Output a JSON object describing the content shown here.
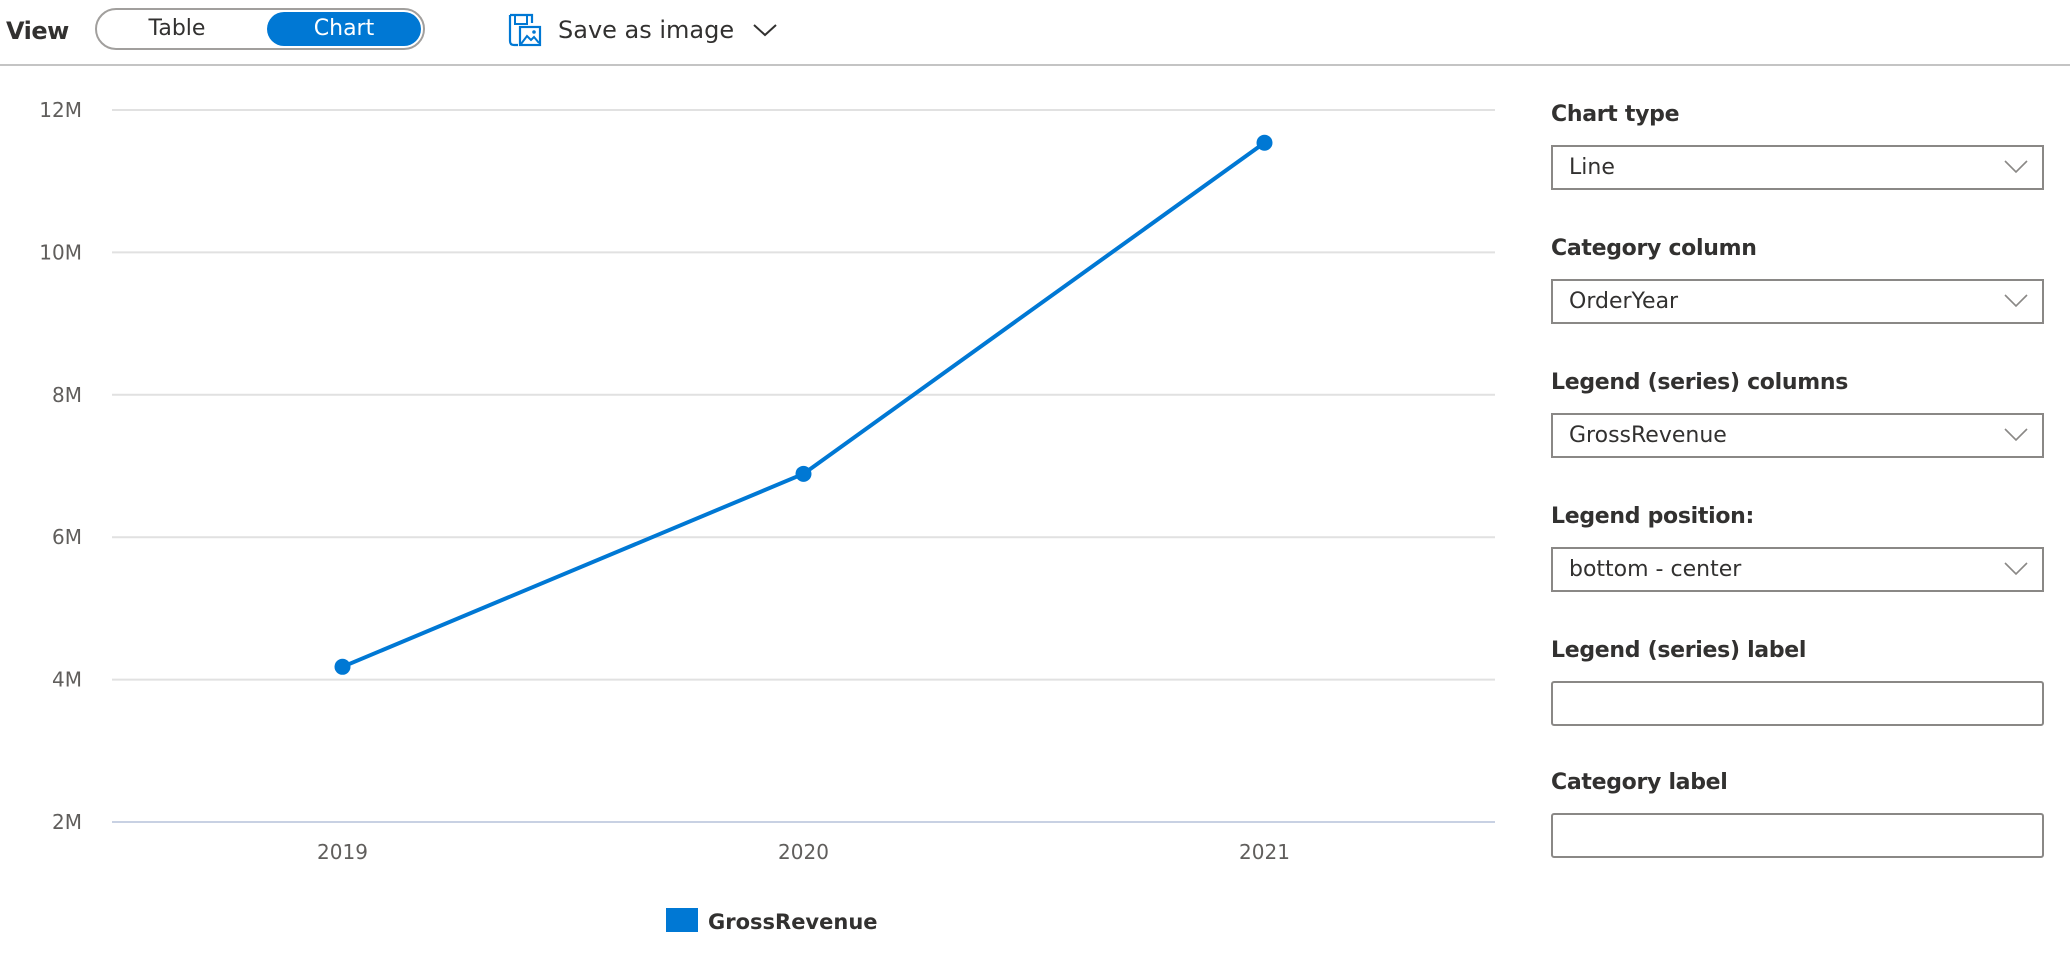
{
  "header": {
    "view_label": "View",
    "toggle": {
      "options": [
        "Table",
        "Chart"
      ],
      "selected": "Chart"
    },
    "save_as_image_label": "Save as image",
    "icons": {
      "save": "save-image-icon",
      "dropdown": "chevron-down-icon"
    }
  },
  "colors": {
    "accent": "#0078d4",
    "gridline": "#e1e1e1",
    "baseline": "#c8d1e3",
    "header_border": "#c4c4c4",
    "input_border": "#8a8886"
  },
  "options_panel": {
    "chart_type": {
      "label": "Chart type",
      "value": "Line"
    },
    "category_column": {
      "label": "Category column",
      "value": "OrderYear"
    },
    "legend_series_columns": {
      "label": "Legend (series) columns",
      "value": "GrossRevenue"
    },
    "legend_position": {
      "label": "Legend position:",
      "value": "bottom - center"
    },
    "legend_series_label": {
      "label": "Legend (series) label",
      "value": "",
      "placeholder": ""
    },
    "category_label": {
      "label": "Category label",
      "value": "",
      "placeholder": ""
    }
  },
  "chart_data": {
    "type": "line",
    "title": "",
    "xlabel": "",
    "ylabel": "",
    "categories": [
      "2019",
      "2020",
      "2021"
    ],
    "series": [
      {
        "name": "GrossRevenue",
        "color": "#0078d4",
        "values": [
          4180000,
          6890000,
          11540000
        ]
      }
    ],
    "ylim": [
      2000000,
      12000000
    ],
    "yticks": [
      2000000,
      4000000,
      6000000,
      8000000,
      10000000,
      12000000
    ],
    "ytick_labels": [
      "2M",
      "4M",
      "6M",
      "8M",
      "10M",
      "12M"
    ],
    "grid": true,
    "legend": {
      "position": "bottom-center",
      "entries": [
        "GrossRevenue"
      ]
    },
    "markers": true
  }
}
